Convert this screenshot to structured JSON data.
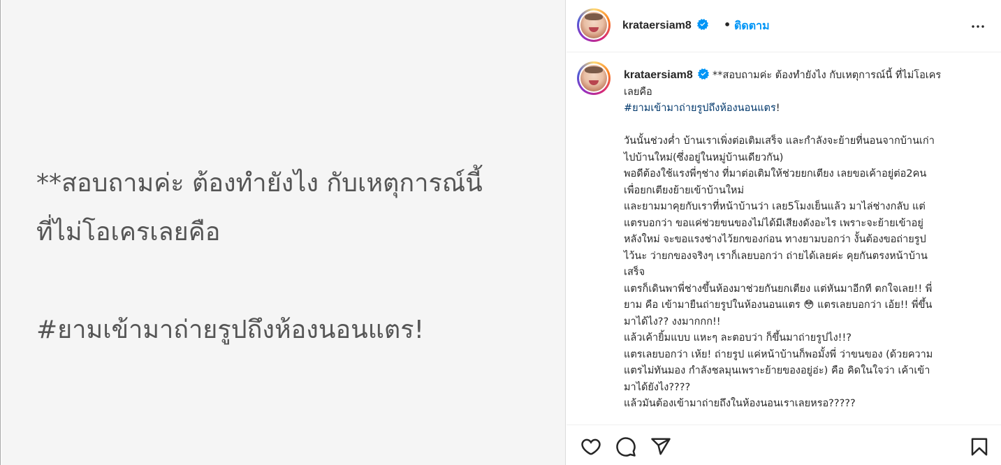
{
  "media": {
    "line1": "**สอบถามค่ะ ต้องทำยังไง กับเหตุการณ์นี้",
    "line2": "ที่ไม่โอเครเลยคือ",
    "hashtag": "#ยามเข้ามาถ่ายรูปถึงห้องนอนแตร!"
  },
  "header": {
    "username": "krataersiam8",
    "separator": "•",
    "follow_label": "ติดตาม",
    "more_icon": "more-horizontal-icon"
  },
  "caption": {
    "username": "krataersiam8",
    "intro": "**สอบถามค่ะ ต้องทำยังไง กับเหตุการณ์นี้ ที่ไม่โอเคร",
    "intro2": "เลยคือ",
    "hashtag": "#ยามเข้ามาถ่ายรูปถึงห้องนอนแตร",
    "hashtag_suffix": "!",
    "body_lines": [
      "วันนั้นช่วงค่ำ บ้านเราเพิ่งต่อเติมเสร็จ และกำลังจะย้ายที่นอนจากบ้านเก่า",
      "ไปบ้านใหม่(ซึ่งอยู่ในหมู่บ้านเดียวกัน)",
      "พอดีต้องใช้แรงพี่ๆช่าง ที่มาต่อเติมให้ช่วยยกเตียง เลยขอเค้าอยู่ต่อ2คน",
      "เพื่อยกเตียงย้ายเข้าบ้านใหม่",
      "และยามมาคุยกับเราที่หน้าบ้านว่า เลย5โมงเย็นแล้ว มาไล่ช่างกลับ แต่",
      "แตรบอกว่า ขอแค่ช่วยขนของไม่ได้มีเสียงดังอะไร เพราะจะย้ายเข้าอยู่",
      "หลังใหม่ จะขอแรงช่างไว้ยกของก่อน ทางยามบอกว่า งั้นต้องขอถ่ายรูป",
      "ไว้นะ ว่ายกของจริงๆ เราก็เลยบอกว่า ถ่ายได้เลยค่ะ คุยกันตรงหน้าบ้าน",
      "เสร็จ",
      "แตรก็เดินพาพี่ช่างขึ้นห้องมาช่วยกันยกเตียง แต่หันมาอีกที ตกใจเลย!! พี่",
      "ยาม คือ เข้ามายืนถ่ายรูปในห้องนอนแตร 😳 แตรเลยบอกว่า เอ้ย!! พี่ขึ้น",
      "มาได้ไง?? งงมากกก!!",
      "แล้วเค้ายิ้มแบบ แหะๆ ละตอบว่า ก็ขึ้นมาถ่ายรูปไง!!?",
      "แตรเลยบอกว่า เห้ย! ถ่ายรูป แค่หน้าบ้านก็พอมั้งพี่ ว่าขนของ (ด้วยความ",
      "แตรไม่ทันมอง กำลังชลมุนเพราะย้ายของอยู่อ่ะ) คือ คิดในใจว่า เค้าเข้า",
      "มาได้ยังไง????",
      "แล้วมันต้องเข้ามาถ่ายถึงในห้องนอนเราเลยหรอ?????"
    ]
  },
  "actions": {
    "like_icon": "heart-icon",
    "comment_icon": "comment-icon",
    "share_icon": "send-icon",
    "save_icon": "bookmark-icon"
  },
  "colors": {
    "follow": "#0095f6",
    "hashtag": "#00376b",
    "verified": "#0095f6",
    "media_bg": "#f5f5f5",
    "media_text": "#555555"
  }
}
